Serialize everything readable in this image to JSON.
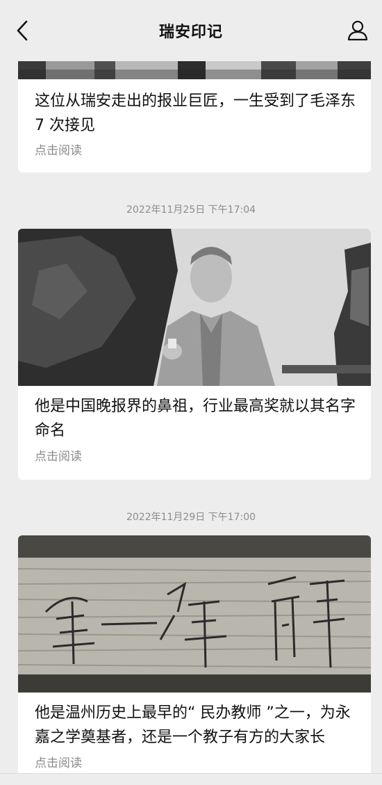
{
  "nav": {
    "title": "瑞安印记",
    "back_icon": "chevron-left-icon",
    "profile_icon": "user-icon"
  },
  "articles": [
    {
      "title": "这位从瑞安走出的报业巨匠，一生受到了毛泽东 7 次接见",
      "cta": "点击阅读"
    },
    {
      "timestamp": "2022年11月25日 下午17:04",
      "title": "他是中国晚报界的鼻祖，行业最高奖就以其名字命名",
      "cta": "点击阅读"
    },
    {
      "timestamp": "2022年11月29日 下午17:00",
      "title": "他是温州历史上最早的“ 民办教师 ”之一，为永嘉之学奠基者，还是一个教子有方的大家长",
      "cta": "点击阅读"
    }
  ],
  "colors": {
    "background": "#ededed",
    "card": "#ffffff",
    "title_text": "#111111",
    "muted_text": "#8a8a8a"
  }
}
